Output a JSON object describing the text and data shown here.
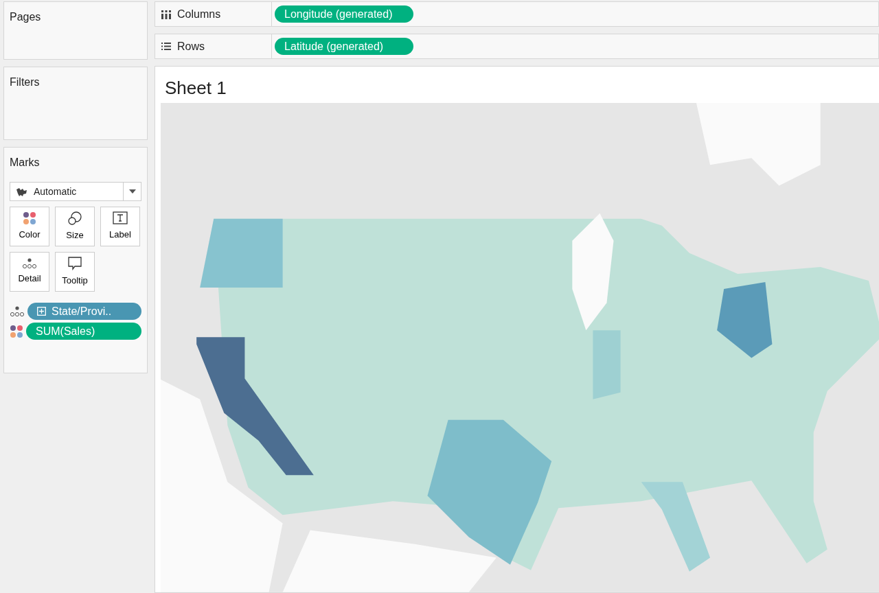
{
  "cards": [
    {
      "title": "Pages"
    },
    {
      "title": "Filters"
    }
  ],
  "shelves": [
    {
      "kind": "columns",
      "label": "Columns",
      "pill": "Longitude (generated)"
    },
    {
      "kind": "rows",
      "label": "Rows",
      "pill": "Latitude (generated)"
    }
  ],
  "marks": {
    "title": "Marks",
    "mark_type": "Automatic",
    "buttons": [
      {
        "kind": "color",
        "label": "Color"
      },
      {
        "kind": "size",
        "label": "Size"
      },
      {
        "kind": "label",
        "label": "Label"
      },
      {
        "kind": "detail",
        "label": "Detail"
      },
      {
        "kind": "tooltip",
        "label": "Tooltip"
      }
    ],
    "fields": [
      {
        "kind": "detail",
        "label": "State/Provi..",
        "color": "#4996b2",
        "expandable": true
      },
      {
        "kind": "color",
        "label": "SUM(Sales)",
        "color": "#00b180",
        "expandable": false
      }
    ]
  },
  "sheet": {
    "title": "Sheet 1"
  }
}
